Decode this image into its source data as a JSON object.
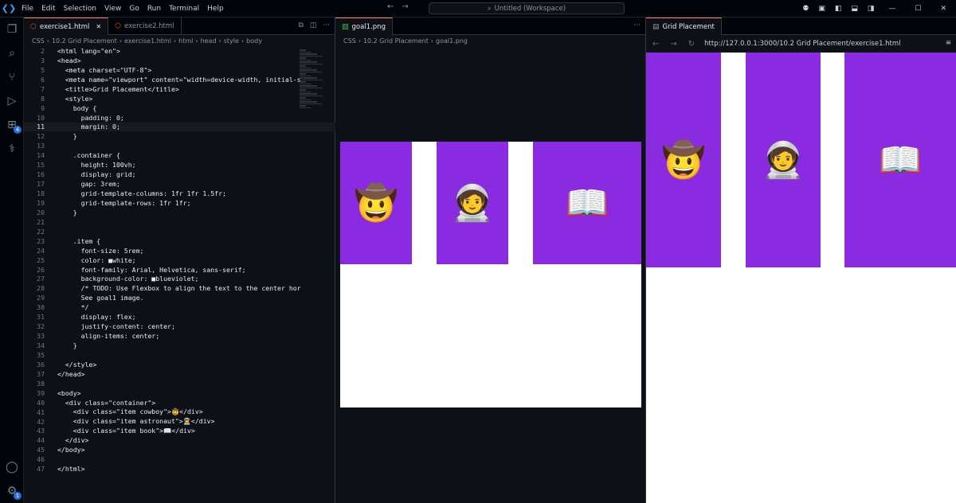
{
  "menu": [
    "File",
    "Edit",
    "Selection",
    "View",
    "Go",
    "Run",
    "Terminal",
    "Help"
  ],
  "workspace_title": "Untitled (Workspace)",
  "activity_badges": {
    "extensions": "4",
    "settings": "1"
  },
  "editor": {
    "tabs": [
      {
        "label": "exercise1.html",
        "active": true
      },
      {
        "label": "exercise2.html",
        "active": false
      }
    ],
    "breadcrumb": [
      "CSS",
      "10.2 Grid Placement",
      "exercise1.html",
      "html",
      "head",
      "style",
      "body"
    ],
    "current_line": 11,
    "lines": [
      {
        "n": "2",
        "code": "<html lang=\"en\">"
      },
      {
        "n": "3",
        "code": "<head>"
      },
      {
        "n": "5",
        "code": "  <meta charset=\"UTF-8\">"
      },
      {
        "n": "6",
        "code": "  <meta name=\"viewport\" content=\"width=device-width, initial-s"
      },
      {
        "n": "7",
        "code": "  <title>Grid Placement</title>"
      },
      {
        "n": "8",
        "code": "  <style>"
      },
      {
        "n": "9",
        "code": "    body {"
      },
      {
        "n": "10",
        "code": "      padding: 0;"
      },
      {
        "n": "11",
        "code": "      margin: 0;"
      },
      {
        "n": "12",
        "code": "    }"
      },
      {
        "n": "13",
        "code": ""
      },
      {
        "n": "14",
        "code": "    .container {"
      },
      {
        "n": "15",
        "code": "      height: 100vh;"
      },
      {
        "n": "16",
        "code": "      display: grid;"
      },
      {
        "n": "17",
        "code": "      gap: 3rem;"
      },
      {
        "n": "18",
        "code": "      grid-template-columns: 1fr 1fr 1.5fr;"
      },
      {
        "n": "19",
        "code": "      grid-template-rows: 1fr 1fr;"
      },
      {
        "n": "20",
        "code": "    }"
      },
      {
        "n": "21",
        "code": ""
      },
      {
        "n": "22",
        "code": ""
      },
      {
        "n": "23",
        "code": "    .item {"
      },
      {
        "n": "24",
        "code": "      font-size: 5rem;"
      },
      {
        "n": "25",
        "code": "      color: ■white;"
      },
      {
        "n": "26",
        "code": "      font-family: Arial, Helvetica, sans-serif;"
      },
      {
        "n": "27",
        "code": "      background-color: ■blueviolet;"
      },
      {
        "n": "28",
        "code": "      /* TODO: Use Flexbox to align the text to the center hor"
      },
      {
        "n": "29",
        "code": "      See goal1 image."
      },
      {
        "n": "30",
        "code": "      */"
      },
      {
        "n": "31",
        "code": "      display: flex;"
      },
      {
        "n": "32",
        "code": "      justify-content: center;"
      },
      {
        "n": "33",
        "code": "      align-items: center;"
      },
      {
        "n": "34",
        "code": "    }"
      },
      {
        "n": "35",
        "code": ""
      },
      {
        "n": "36",
        "code": "  </style>"
      },
      {
        "n": "37",
        "code": "</head>"
      },
      {
        "n": "38",
        "code": ""
      },
      {
        "n": "39",
        "code": "<body>"
      },
      {
        "n": "40",
        "code": "  <div class=\"container\">"
      },
      {
        "n": "41",
        "code": "    <div class=\"item cowboy\">🤠</div>"
      },
      {
        "n": "42",
        "code": "    <div class=\"item astronaut\">🧑‍🚀</div>"
      },
      {
        "n": "43",
        "code": "    <div class=\"item book\">📖</div>"
      },
      {
        "n": "44",
        "code": "  </div>"
      },
      {
        "n": "45",
        "code": "</body>"
      },
      {
        "n": "46",
        "code": ""
      },
      {
        "n": "47",
        "code": "</html>"
      }
    ]
  },
  "image_viewer": {
    "tab_label": "goal1.png",
    "breadcrumb": [
      "CSS",
      "10.2 Grid Placement",
      "goal1.png"
    ],
    "items": [
      "🤠",
      "🧑‍🚀",
      "📖"
    ]
  },
  "browser": {
    "tab_label": "Grid Placement",
    "url": "http://127.0.0.1:3000/10.2 Grid Placement/exercise1.html",
    "items": [
      "🤠",
      "🧑‍🚀",
      "📖"
    ]
  },
  "colors": {
    "item_bg": "#8a2be2",
    "accent": "#f78166"
  }
}
